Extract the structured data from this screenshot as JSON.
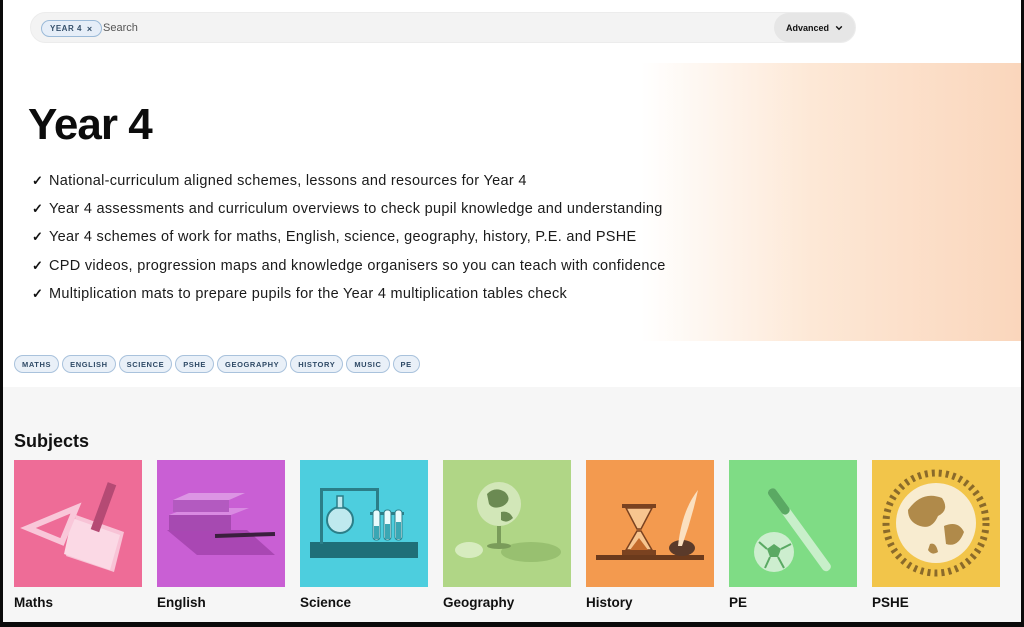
{
  "search": {
    "chip_label": "YEAR 4",
    "chip_close": "×",
    "placeholder": "Search",
    "advanced_label": "Advanced"
  },
  "hero": {
    "title": "Year 4",
    "check_glyph": "✓",
    "bullets": [
      "National-curriculum aligned schemes, lessons and resources for Year 4",
      "Year 4 assessments and curriculum overviews to check pupil knowledge and understanding",
      "Year 4 schemes of work for maths, English, science, geography, history, P.E. and PSHE",
      "CPD videos, progression maps and knowledge organisers so you can teach with confidence",
      "Multiplication mats to prepare pupils for the Year 4 multiplication tables check"
    ]
  },
  "tags": [
    "MATHS",
    "ENGLISH",
    "SCIENCE",
    "PSHE",
    "GEOGRAPHY",
    "HISTORY",
    "MUSIC",
    "PE"
  ],
  "subjects": {
    "heading": "Subjects",
    "cards": [
      {
        "label": "Maths",
        "color": "#ee6c97",
        "icon": "set-square-icon"
      },
      {
        "label": "English",
        "color": "#c95fd4",
        "icon": "books-icon"
      },
      {
        "label": "Science",
        "color": "#4dcede",
        "icon": "lab-equipment-icon"
      },
      {
        "label": "Geography",
        "color": "#b0d686",
        "icon": "globe-icon"
      },
      {
        "label": "History",
        "color": "#f39a4f",
        "icon": "hourglass-icon"
      },
      {
        "label": "PE",
        "color": "#7fdc85",
        "icon": "bat-and-ball-icon"
      },
      {
        "label": "PSHE",
        "color": "#f2c54a",
        "icon": "world-people-icon"
      }
    ]
  }
}
